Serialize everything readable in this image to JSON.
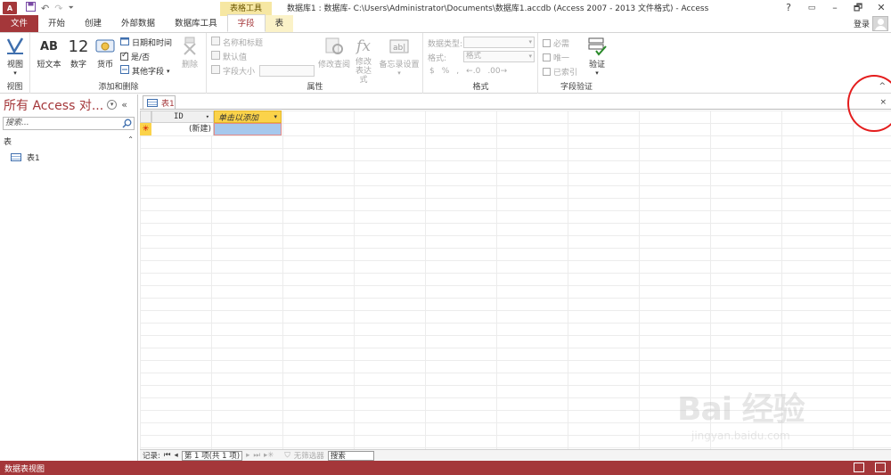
{
  "app": {
    "logo_text": "A",
    "window_title": "数据库1 : 数据库- C:\\Users\\Administrator\\Documents\\数据库1.accdb (Access 2007 - 2013 文件格式) - Access",
    "contextual_group": "表格工具",
    "window_controls": {
      "help": "?",
      "minimize": "–",
      "restore": "🗗",
      "close": "✕"
    },
    "login": "登录"
  },
  "tabs": [
    {
      "label": "文件",
      "kind": "file"
    },
    {
      "label": "开始",
      "kind": "normal"
    },
    {
      "label": "创建",
      "kind": "normal"
    },
    {
      "label": "外部数据",
      "kind": "normal"
    },
    {
      "label": "数据库工具",
      "kind": "normal"
    },
    {
      "label": "字段",
      "kind": "active"
    },
    {
      "label": "表",
      "kind": "tool"
    }
  ],
  "ribbon": {
    "views": {
      "label": "视图",
      "group": "视图"
    },
    "add_delete": {
      "group": "添加和删除",
      "short_text": "短文本",
      "short_text_icon": "AB",
      "number": "数字",
      "number_icon": "12",
      "currency": "货币",
      "datetime": "日期和时间",
      "yesno": "是/否",
      "more_fields": "其他字段",
      "delete": "删除"
    },
    "properties": {
      "group": "属性",
      "name_caption": "名称和标题",
      "default_value": "默认值",
      "field_size": "字段大小",
      "modify_lookups": "修改查阅",
      "modify_expression": "修改\n表达式",
      "memo_settings": "备忘录设置"
    },
    "formatting": {
      "group": "格式",
      "data_type": "数据类型:",
      "format": "格式:",
      "format_value": "格式"
    },
    "validation": {
      "group": "字段验证",
      "required": "必需",
      "unique": "唯一",
      "indexed": "已索引",
      "validate": "验证"
    },
    "collapse": "^"
  },
  "nav": {
    "title": "所有 Access 对...",
    "search_placeholder": "搜索...",
    "group": "表",
    "items": [
      {
        "label": "表1"
      }
    ]
  },
  "doc": {
    "tab_label": "表1",
    "close": "×",
    "columns": {
      "id": "ID",
      "add": "单击以添加"
    },
    "new_row": "(新建)"
  },
  "recnav": {
    "label": "记录:",
    "position": "第 1 项(共 1 项)",
    "no_filter": "无筛选器",
    "search": "搜索"
  },
  "status": {
    "text": "数据表视图"
  },
  "watermark": {
    "main": "Bai 经验",
    "sub": "jingyan.baidu.com"
  },
  "colors": {
    "accent": "#a4373a",
    "tool_header": "#f6e7a3",
    "selection": "#fbd34a",
    "annotation": "#e41d1d"
  }
}
